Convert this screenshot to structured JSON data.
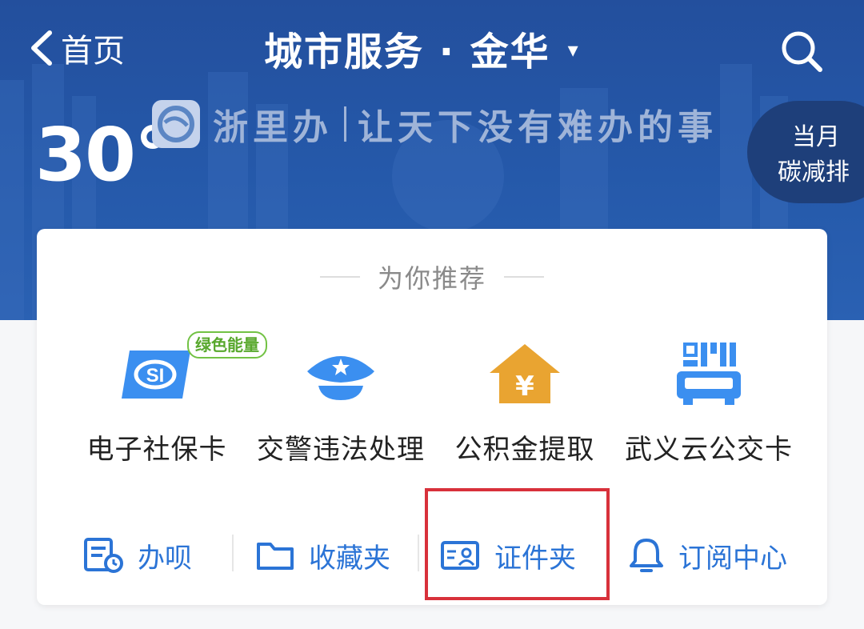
{
  "header": {
    "back_label": "首页",
    "title": "城市服务 · 金华",
    "caret": "▾",
    "search_icon": "search-icon"
  },
  "weather": {
    "temperature": "30°"
  },
  "banner": {
    "slogan_brand": "浙里办",
    "slogan_text": "让天下没有难办的事"
  },
  "carbon": {
    "line1": "当月",
    "line2": "碳减排"
  },
  "recommend": {
    "title": "为你推荐",
    "services": [
      {
        "label": "电子社保卡",
        "icon": "social-security-card-icon",
        "badge": "绿色能量"
      },
      {
        "label": "交警违法处理",
        "icon": "police-cap-icon"
      },
      {
        "label": "公积金提取",
        "icon": "housing-fund-icon"
      },
      {
        "label": "武义云公交卡",
        "icon": "bus-qr-card-icon"
      }
    ]
  },
  "tools": [
    {
      "label": "办呗",
      "icon": "task-list-icon"
    },
    {
      "label": "收藏夹",
      "icon": "folder-icon"
    },
    {
      "label": "证件夹",
      "icon": "id-card-icon"
    },
    {
      "label": "订阅中心",
      "icon": "bell-icon"
    }
  ],
  "colors": {
    "header_blue": "#2559aa",
    "accent_blue": "#2b74d6",
    "icon_blue": "#3b8ff0",
    "fund_orange": "#e9a431",
    "badge_green": "#72c244",
    "highlight_red": "#d8313b"
  }
}
